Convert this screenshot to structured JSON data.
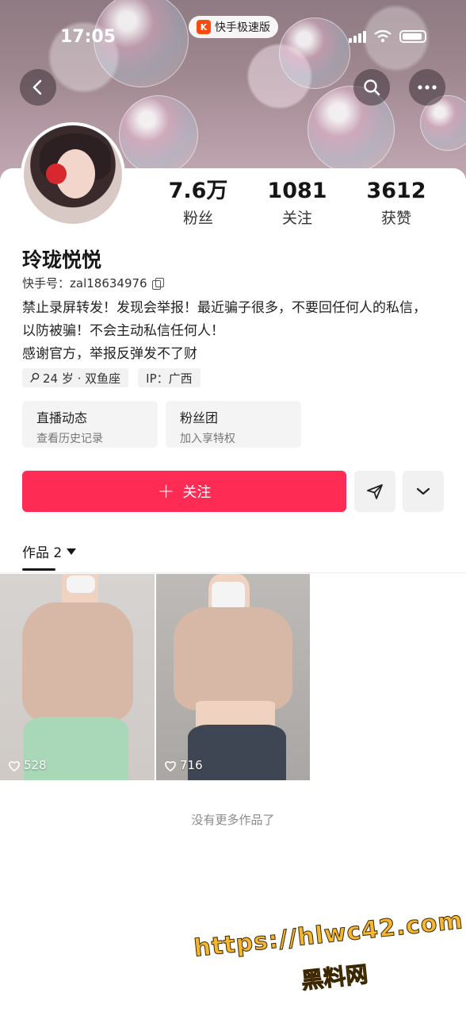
{
  "status_bar": {
    "time": "17:05",
    "app_badge": "快手极速版"
  },
  "profile": {
    "stats": [
      {
        "value": "7.6万",
        "label": "粉丝"
      },
      {
        "value": "1081",
        "label": "关注"
      },
      {
        "value": "3612",
        "label": "获赞"
      }
    ],
    "nickname": "玲珑悦悦",
    "kuaishou_id": "快手号：zal18634976",
    "bio": [
      "禁止录屏转发！发现会举报！最近骗子很多，不要回任何人的私信，",
      "以防被骗！不会主动私信任何人！",
      "感谢官方，举报反弹发不了财"
    ],
    "tags": [
      "24 岁 · 双鱼座",
      "IP：广西"
    ],
    "quick_cards": [
      {
        "title": "直播动态",
        "subtitle": "查看历史记录"
      },
      {
        "title": "粉丝团",
        "subtitle": "加入享特权"
      }
    ]
  },
  "actions": {
    "follow_label": "关注"
  },
  "works": {
    "tab_label": "作品 2",
    "items": [
      {
        "likes": "528"
      },
      {
        "likes": "716"
      }
    ],
    "no_more": "没有更多作品了"
  },
  "watermark": {
    "url": "https://hlwc42.com",
    "name": "黑料网"
  },
  "colors": {
    "accent": "#fe2c55"
  },
  "icons": [
    "back-icon",
    "search-icon",
    "more-icon",
    "copy-icon",
    "plus-icon",
    "send-icon",
    "chevron-down-icon",
    "heart-icon"
  ]
}
